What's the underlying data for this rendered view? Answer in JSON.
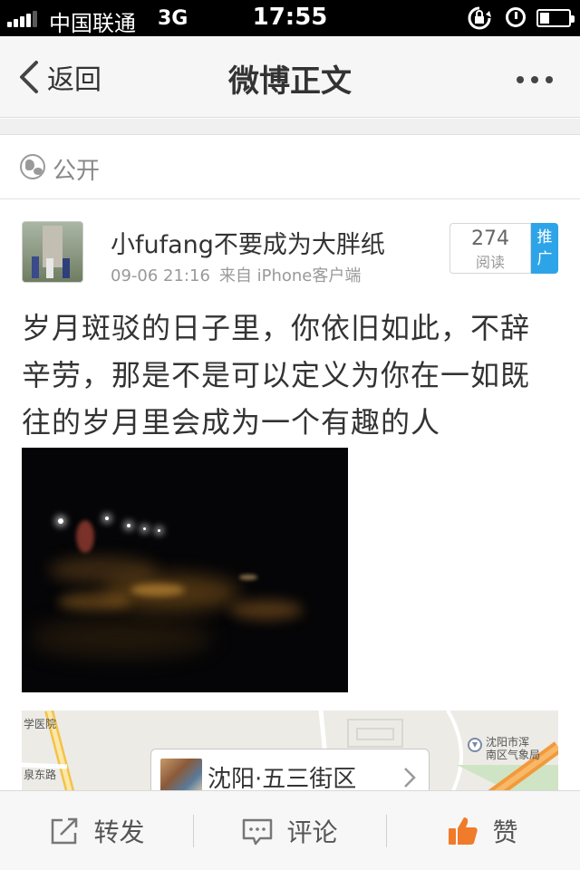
{
  "status_bar": {
    "carrier": "中国联通",
    "network": "3G",
    "time": "17:55"
  },
  "nav": {
    "back_label": "返回",
    "title": "微博正文",
    "more_icon": "more-dots-icon"
  },
  "visibility": {
    "icon": "globe-icon",
    "label": "公开"
  },
  "post": {
    "username": "小fufang不要成为大胖纸",
    "time": "09-06 21:16",
    "source": "来自 iPhone客户端",
    "read_count": "274",
    "read_label": "阅读",
    "promote_label": "推广",
    "text": "岁月斑驳的日子里，你依旧如此，不辞辛劳，那是不是可以定义为你在一如既往的岁月里会成为一个有趣的人",
    "photo_alt": "night street photo"
  },
  "map": {
    "labels": [
      "学医院",
      "泉东路",
      "沈阳市浑",
      "南区气象局"
    ],
    "location_name": "沈阳·五三街区"
  },
  "toolbar": {
    "repost_label": "转发",
    "comment_label": "评论",
    "like_label": "赞"
  },
  "colors": {
    "promote_blue": "#2ea4e8",
    "like_orange": "#f07b2a"
  }
}
